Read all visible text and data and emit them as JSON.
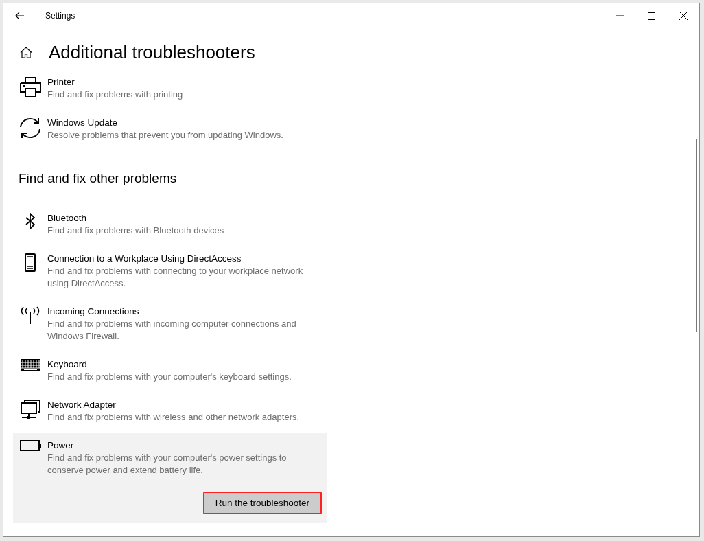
{
  "window": {
    "title": "Settings"
  },
  "page": {
    "title": "Additional troubleshooters"
  },
  "sections": [
    {
      "items": [
        {
          "kind": "printer",
          "title": "Printer",
          "description": "Find and fix problems with printing",
          "selected": false
        },
        {
          "kind": "sync",
          "title": "Windows Update",
          "description": "Resolve problems that prevent you from updating Windows.",
          "selected": false
        }
      ]
    },
    {
      "heading": "Find and fix other problems",
      "items": [
        {
          "kind": "bluetooth",
          "title": "Bluetooth",
          "description": "Find and fix problems with Bluetooth devices",
          "selected": false
        },
        {
          "kind": "phone",
          "title": "Connection to a Workplace Using DirectAccess",
          "description": "Find and fix problems with connecting to your workplace network using DirectAccess.",
          "selected": false
        },
        {
          "kind": "antenna",
          "title": "Incoming Connections",
          "description": "Find and fix problems with incoming computer connections and Windows Firewall.",
          "selected": false
        },
        {
          "kind": "keyboard",
          "title": "Keyboard",
          "description": "Find and fix problems with your computer's keyboard settings.",
          "selected": false
        },
        {
          "kind": "network",
          "title": "Network Adapter",
          "description": "Find and fix problems with wireless and other network adapters.",
          "selected": false
        },
        {
          "kind": "battery",
          "title": "Power",
          "description": "Find and fix problems with your computer's power settings to conserve power and extend battery life.",
          "selected": true
        }
      ]
    }
  ],
  "run_button": "Run the troubleshooter"
}
